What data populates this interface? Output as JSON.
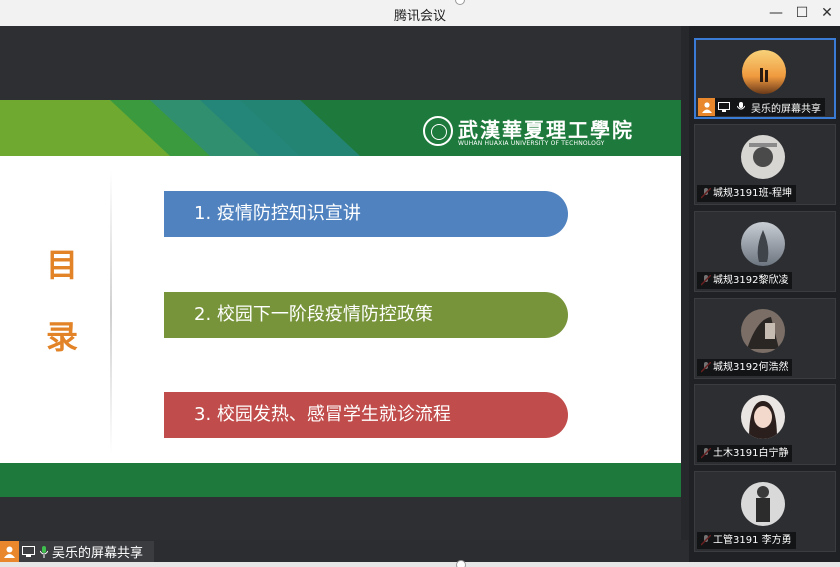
{
  "window": {
    "title": "腾讯会议"
  },
  "slide": {
    "university_cn": "武漢華夏理工學院",
    "university_en": "WUHAN HUAXIA UNIVERSITY OF TECHNOLOGY",
    "toc_chars": [
      "目",
      "录"
    ],
    "items": [
      {
        "label": "1. 疫情防控知识宣讲",
        "color": "#4f82bf"
      },
      {
        "label": "2. 校园下一阶段疫情防控政策",
        "color": "#77943b"
      },
      {
        "label": "3. 校园发热、感冒学生就诊流程",
        "color": "#c04d4b"
      }
    ]
  },
  "presenter": {
    "label": "吴乐的屏幕共享"
  },
  "participants": [
    {
      "name": "吴乐的屏幕共享",
      "sharing": true
    },
    {
      "name": "城规3191班-程坤"
    },
    {
      "name": "城规3192黎欣凌"
    },
    {
      "name": "城规3192何浩然"
    },
    {
      "name": "土木3191白宁静"
    },
    {
      "name": "工管3191 李方勇"
    }
  ]
}
